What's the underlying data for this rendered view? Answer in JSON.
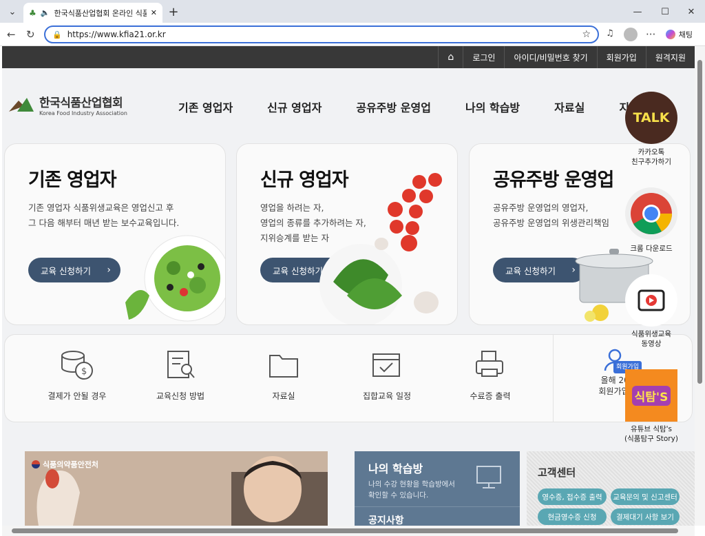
{
  "browser": {
    "tab_title": "한국식품산업협회 온라인 식품",
    "url": "https://www.kfia21.or.kr",
    "chat_label": "채팅"
  },
  "topbar": {
    "items": [
      "로그인",
      "아이디/비밀번호 찾기",
      "회원가입",
      "원격지원"
    ]
  },
  "logo": {
    "korean": "한국식품산업협회",
    "english": "Korea Food Industry Association"
  },
  "gnb": [
    "기존 영업자",
    "신규 영업자",
    "공유주방 운영업",
    "나의 학습방",
    "자료실",
    "지원"
  ],
  "cards": [
    {
      "title": "기존 영업자",
      "desc": "기존 영업자 식품위생교육은 영업신고 후\n그 다음 해부터 매년 받는 보수교육입니다.",
      "button": "교육 신청하기"
    },
    {
      "title": "신규 영업자",
      "desc": "영업을 하려는 자,\n영업의 종류를 추가하려는 자,\n지위승계를 받는 자",
      "button": "교육 신청하기"
    },
    {
      "title": "공유주방 운영업",
      "desc": "공유주방 운영업의 영업자,\n공유주방 운영업의 위생관리책임",
      "button": "교육 신청하기"
    }
  ],
  "quick": [
    "결제가 안될 경우",
    "교육신청 방법",
    "자료실",
    "집합교육 일정",
    "수료증 출력"
  ],
  "join_box": {
    "badge": "회원가입",
    "line1": "올해 202",
    "line2": "회원가입하"
  },
  "side": {
    "talk_label": "TALK",
    "kakao": "카카오톡\n친구추가하기",
    "chrome": "크롬 다운로드",
    "video": "식품위생교육\n동영상",
    "youtube_logo": "식탐'S",
    "youtube": "유튜브 식탐's\n(식품탐구 Story)"
  },
  "news": {
    "label": "식품의약품안전처"
  },
  "study": {
    "title": "나의 학습방",
    "desc": "나의 수강 현황을 학습방에서\n확인할 수 있습니다.",
    "next": "공지사항"
  },
  "cs": {
    "title": "고객센터",
    "pills": [
      "영수증, 접수증 출력",
      "교육문의 및 신고센터",
      "현금영수증 신청",
      "결제대기 사항 보기"
    ]
  },
  "colors": {
    "accent": "#3d5470",
    "brand_green": "#3f8a3a",
    "brand_brown": "#6b4a2b",
    "teal": "#5aa7b3"
  }
}
